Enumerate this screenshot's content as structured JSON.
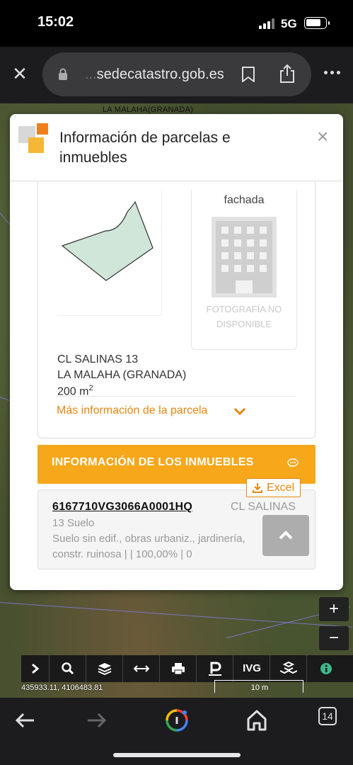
{
  "status_bar": {
    "time": "15:02",
    "network": "5G",
    "battery_fraction": 0.78
  },
  "browser": {
    "url_prefix": "...",
    "url_host": "sedecatastro.gob.es",
    "tab_count": "14"
  },
  "map": {
    "top_label": "LA MALAHA(GRANADA)",
    "coordinates": "435933.11, 4106483.81",
    "scale_label": "10 m",
    "zoom_in": "+",
    "zoom_out": "−",
    "toolbar": [
      {
        "name": "expand",
        "label": "›"
      },
      {
        "name": "search",
        "label": ""
      },
      {
        "name": "layers",
        "label": ""
      },
      {
        "name": "measure",
        "label": "⟷"
      },
      {
        "name": "print",
        "label": ""
      },
      {
        "name": "parking",
        "label": ""
      },
      {
        "name": "ivg",
        "label": "IVG"
      },
      {
        "name": "buildings",
        "label": ""
      },
      {
        "name": "info",
        "label": ""
      }
    ]
  },
  "modal": {
    "title": "Información de parcelas e inmuebles",
    "close": "×",
    "parcel": {
      "facade_label": "fachada",
      "no_photo_line1": "FOTOGRAFÍA NO",
      "no_photo_line2": "DISPONIBLE",
      "address_line1": "CL SALINAS 13",
      "address_line2": "LA MALAHA (GRANADA)",
      "area_value": "200 m",
      "area_unit_sup": "2",
      "more_info": "Más información de la parcela"
    },
    "inmuebles": {
      "button_label": "INFORMACIÓN DE LOS INMUEBLES",
      "excel_label": "Excel",
      "reference": "6167710VG3066A0001HQ",
      "street": "CL SALINAS",
      "line2": "13 Suelo",
      "line3": "Suelo sin edif., obras urbaniz., jardinería,",
      "line4": "constr. ruinosa | | 100,00% | 0"
    }
  },
  "colors": {
    "accent_orange": "#f6a71a",
    "link_orange": "#e8860f",
    "parcel_fill": "#cfe6d8"
  }
}
